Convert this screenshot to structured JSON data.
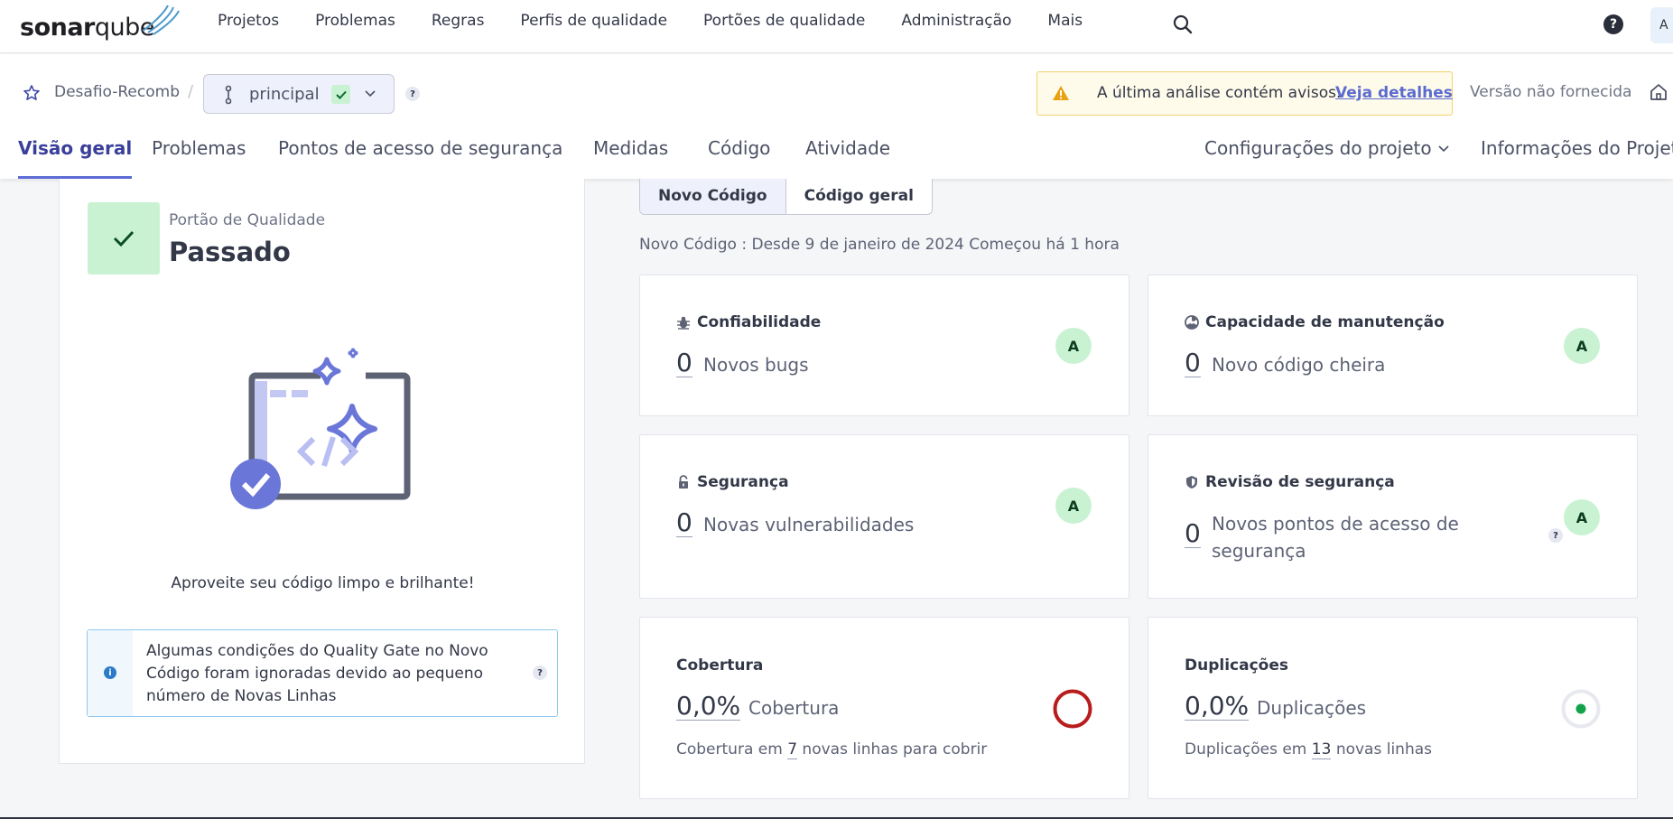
{
  "nav": {
    "logo_bold": "sonar",
    "logo_thin": "qube",
    "items": [
      "Projetos",
      "Problemas",
      "Regras",
      "Perfis de qualidade",
      "Portões de qualidade",
      "Administração",
      "Mais"
    ],
    "help": "?",
    "avatar": "A"
  },
  "project": {
    "name": "Desafio-Recomb",
    "sep": "/",
    "branch": "principal",
    "branch_help": "?",
    "warning_text": "A última análise contém avisos.",
    "warning_link": "Veja detalhes",
    "version": "Versão não fornecida"
  },
  "tabs": {
    "overview": "Visão geral",
    "issues": "Problemas",
    "hotspots": "Pontos de acesso de segurança",
    "measures": "Medidas",
    "code": "Código",
    "activity": "Atividade",
    "settings": "Configurações do projeto",
    "info": "Informações do Projeto"
  },
  "quality_gate": {
    "label": "Portão de Qualidade",
    "status": "Passado",
    "message": "Aproveite seu código limpo e brilhante!",
    "info_icon": "i",
    "info_text": "Algumas condições do Quality Gate no Novo Código foram ignoradas devido ao pequeno número de Novas Linhas",
    "info_help": "?"
  },
  "code_toggle": {
    "new_code": "Novo Código",
    "overall": "Código geral"
  },
  "period": "Novo Código : Desde 9 de janeiro de 2024  Começou há 1 hora",
  "metrics": {
    "reliability": {
      "title": "Confiabilidade",
      "value": "0",
      "label": "Novos bugs",
      "rating": "A"
    },
    "maintainability": {
      "title": "Capacidade de manutenção",
      "value": "0",
      "label": "Novo código cheira",
      "rating": "A"
    },
    "security": {
      "title": "Segurança",
      "value": "0",
      "label": "Novas vulnerabilidades",
      "rating": "A"
    },
    "hotspots": {
      "title": "Revisão de segurança",
      "value": "0",
      "label_1": "Novos pontos de acesso de",
      "label_2": "segurança",
      "help": "?",
      "rating": "A"
    },
    "coverage": {
      "title": "Cobertura",
      "value": "0,0%",
      "label": "Cobertura",
      "sub_prefix": "Cobertura em",
      "sub_num": "7",
      "sub_suffix": "novas linhas para cobrir"
    },
    "duplications": {
      "title": "Duplicações",
      "value": "0,0%",
      "label": "Duplicações",
      "sub_prefix": "Duplicações em",
      "sub_num": "13",
      "sub_suffix": "novas linhas"
    }
  },
  "colors": {
    "accent": "#5d6cd5",
    "pass_bg": "#c9f2d3",
    "pass_fg": "#0b6b2e",
    "coverage_ring": "#b81c1c",
    "dup_dot": "#12a34a"
  }
}
